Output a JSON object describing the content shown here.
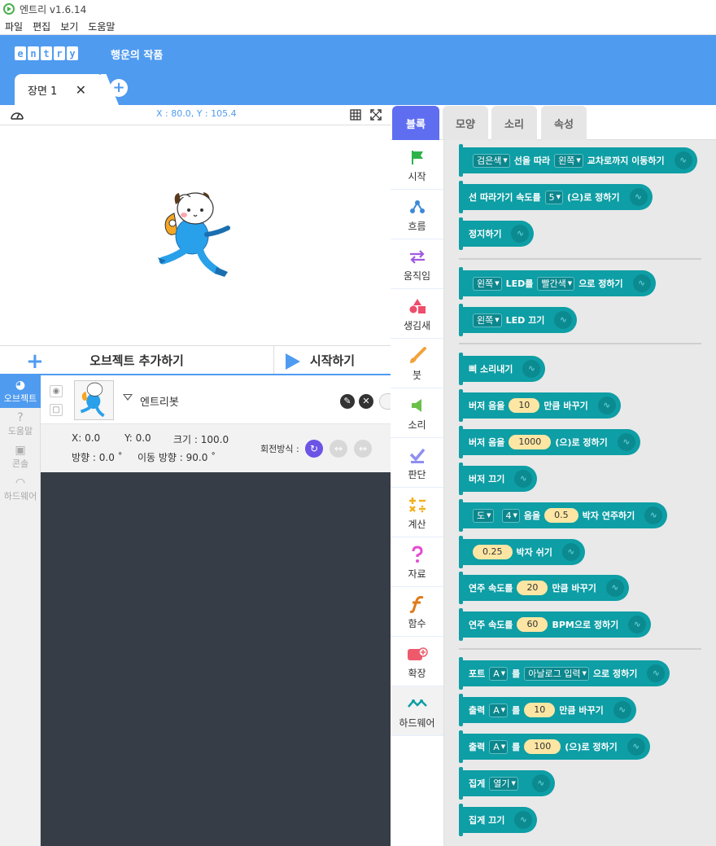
{
  "window": {
    "title": "엔트리 v1.6.14"
  },
  "menu": [
    "파일",
    "편집",
    "보기",
    "도움말"
  ],
  "header": {
    "logo_letters": [
      "e",
      "n",
      "t",
      "r",
      "y"
    ],
    "project_title": "행운의 작품",
    "scene_tab": "장면 1",
    "add_scene": "+"
  },
  "stage": {
    "coords": "X : 80.0, Y : 105.4",
    "add_object": "오브젝트 추가하기",
    "start": "시작하기"
  },
  "side_nav": [
    {
      "label": "오브젝트",
      "icon": "object-icon"
    },
    {
      "label": "도움말",
      "icon": "help-icon"
    },
    {
      "label": "콘솔",
      "icon": "console-icon"
    },
    {
      "label": "하드웨어",
      "icon": "hardware-icon"
    }
  ],
  "object": {
    "name": "엔트리봇",
    "x": "X:  0.0",
    "y": "Y:  0.0",
    "size": "크기 : 100.0",
    "direction": "방향 : 0.0 ˚",
    "move_direction": "이동 방향 : 90.0 ˚",
    "rotation_label": "회전방식 :"
  },
  "block_tabs": [
    "블록",
    "모양",
    "소리",
    "속성"
  ],
  "categories": [
    {
      "label": "시작",
      "icon": "flag-icon",
      "color": "#2db34a"
    },
    {
      "label": "흐름",
      "icon": "flow-icon",
      "color": "#3d8ad6"
    },
    {
      "label": "움직임",
      "icon": "move-icon",
      "color": "#a05be0"
    },
    {
      "label": "생김새",
      "icon": "shape-icon",
      "color": "#ee4d6b"
    },
    {
      "label": "붓",
      "icon": "brush-icon",
      "color": "#f2a23b"
    },
    {
      "label": "소리",
      "icon": "sound-icon",
      "color": "#6cc04a"
    },
    {
      "label": "판단",
      "icon": "judge-icon",
      "color": "#8f8ff0"
    },
    {
      "label": "계산",
      "icon": "calc-icon",
      "color": "#f2b01e"
    },
    {
      "label": "자료",
      "icon": "data-icon",
      "color": "#e34cd2"
    },
    {
      "label": "함수",
      "icon": "func-icon",
      "color": "#e07a1a"
    },
    {
      "label": "확장",
      "icon": "extension-icon",
      "color": "#ee5a6c"
    },
    {
      "label": "하드웨어",
      "icon": "hardware-icon",
      "color": "#0e9ea5"
    }
  ],
  "blocks": {
    "b1": {
      "d1": "검은색",
      "t1": "선을 따라",
      "d2": "왼쪽",
      "t2": "교차로까지 이동하기"
    },
    "b2": {
      "t1": "선 따라가기 속도를",
      "d1": "5",
      "t2": "(으)로 정하기"
    },
    "b3": {
      "t1": "정지하기"
    },
    "b4": {
      "d1": "왼쪽",
      "t1": "LED를",
      "d2": "빨간색",
      "t2": "으로 정하기"
    },
    "b5": {
      "d1": "왼쪽",
      "t1": "LED 끄기"
    },
    "b6": {
      "t1": "삐 소리내기"
    },
    "b7": {
      "t1": "버저 음을",
      "n1": "10",
      "t2": "만큼 바꾸기"
    },
    "b8": {
      "t1": "버저 음을",
      "n1": "1000",
      "t2": "(으)로 정하기"
    },
    "b9": {
      "t1": "버저 끄기"
    },
    "b10": {
      "d1": "도",
      "d2": "4",
      "t1": "음을",
      "n1": "0.5",
      "t2": "박자 연주하기"
    },
    "b11": {
      "n1": "0.25",
      "t1": "박자 쉬기"
    },
    "b12": {
      "t1": "연주 속도를",
      "n1": "20",
      "t2": "만큼 바꾸기"
    },
    "b13": {
      "t1": "연주 속도를",
      "n1": "60",
      "t2": "BPM으로 정하기"
    },
    "b14": {
      "t1": "포트",
      "d1": "A",
      "t2": "를",
      "d2": "아날로그 입력",
      "t3": "으로 정하기"
    },
    "b15": {
      "t1": "출력",
      "d1": "A",
      "t2": "를",
      "n1": "10",
      "t3": "만큼 바꾸기"
    },
    "b16": {
      "t1": "출력",
      "d1": "A",
      "t2": "를",
      "n1": "100",
      "t3": "(으)로 정하기"
    },
    "b17": {
      "t1": "집게",
      "d1": "열기"
    },
    "b18": {
      "t1": "집게 끄기"
    }
  }
}
